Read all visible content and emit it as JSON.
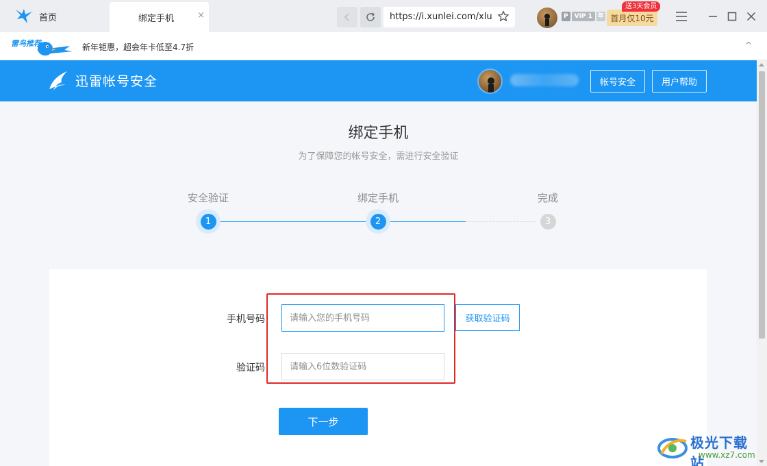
{
  "browser": {
    "home_tab_label": "首页",
    "active_tab_title": "绑定手机",
    "tab_close": "×",
    "url": "https://i.xunlei.com/xluser",
    "vip": {
      "p": "P",
      "level": "VIP 1",
      "year": "年"
    },
    "promo_button": "首月仅10元",
    "promo_tag": "送3天会员"
  },
  "notice": {
    "badge_text": "雷鸟推荐",
    "text": "新年钜惠，超会年卡低至4.7折",
    "collapse": "^"
  },
  "header": {
    "brand": "迅雷帐号安全",
    "buttons": {
      "security": "帐号安全",
      "help": "用户帮助"
    }
  },
  "page": {
    "title": "绑定手机",
    "subtitle": "为了保障您的帐号安全，需进行安全验证"
  },
  "steps": [
    {
      "label": "安全验证",
      "number": "1",
      "state": "active"
    },
    {
      "label": "绑定手机",
      "number": "2",
      "state": "active"
    },
    {
      "label": "完成",
      "number": "3",
      "state": "idle"
    }
  ],
  "form": {
    "phone_label": "手机号码",
    "phone_placeholder": "请输入您的手机号码",
    "get_code_button": "获取验证码",
    "code_label": "验证码",
    "code_placeholder": "请输入6位数验证码",
    "next_button": "下一步"
  },
  "watermark": {
    "title": "极光下载站",
    "url": "www.xz7.com"
  },
  "colors": {
    "primary": "#1d95f2",
    "highlight": "#e02828",
    "promo": "#f6dba1"
  }
}
